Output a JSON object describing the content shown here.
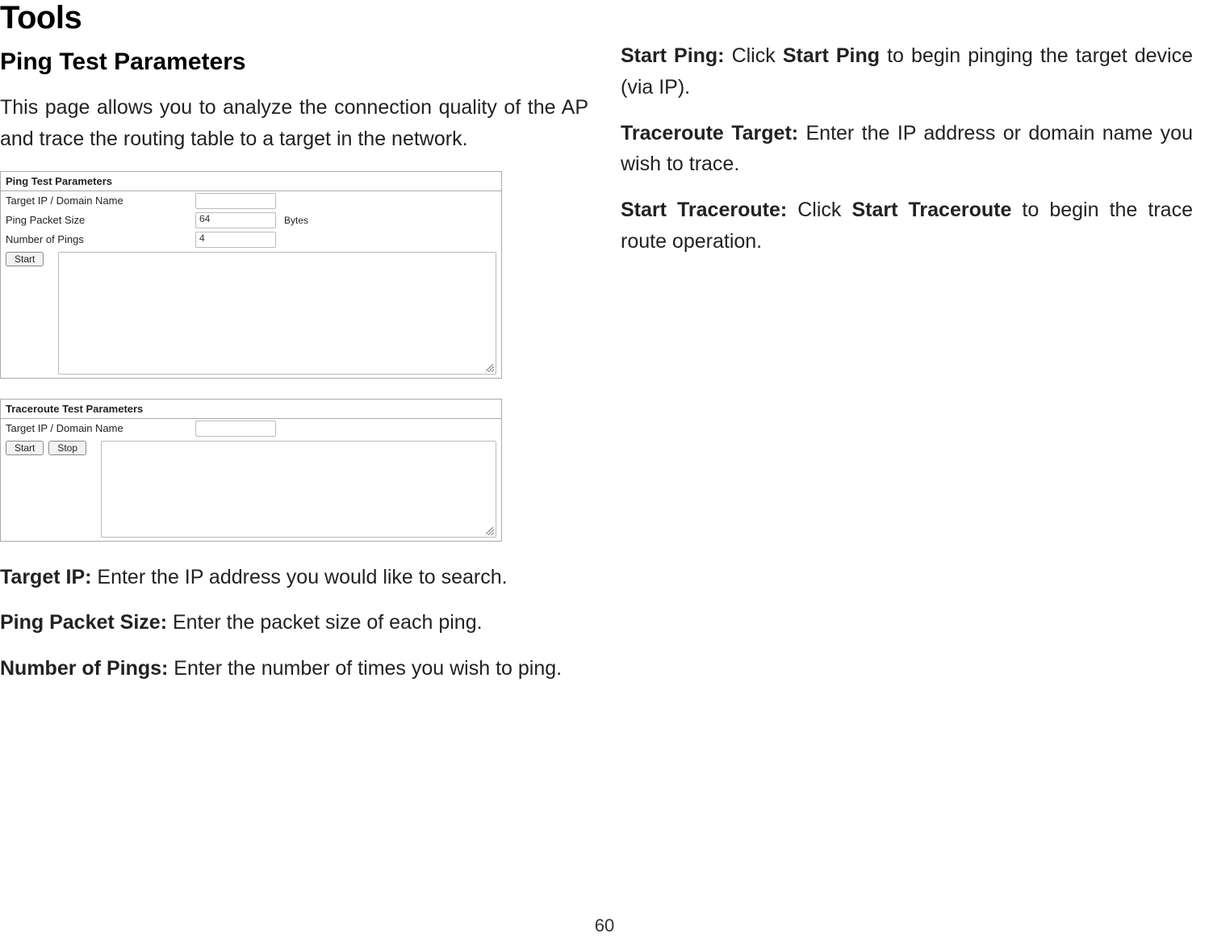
{
  "page_title": "Tools",
  "page_number": "60",
  "left_column": {
    "section_title": "Ping Test Parameters",
    "intro": "This page allows you to analyze the connection quality of the AP and trace the routing table to a target in the network.",
    "ping_panel": {
      "title": "Ping Test Parameters",
      "rows": {
        "target_label": "Target IP / Domain Name",
        "target_value": "",
        "packet_label": "Ping Packet Size",
        "packet_value": "64",
        "packet_unit": "Bytes",
        "num_label": "Number of Pings",
        "num_value": "4"
      },
      "start_button": "Start"
    },
    "traceroute_panel": {
      "title": "Traceroute Test Parameters",
      "target_label": "Target IP / Domain Name",
      "target_value": "",
      "start_button": "Start",
      "stop_button": "Stop"
    },
    "definitions": {
      "target_ip_term": "Target IP:",
      "target_ip_text": " Enter the IP address you would like to search.",
      "packet_size_term": "Ping Packet Size:",
      "packet_size_text": " Enter the packet size of each ping.",
      "num_pings_term": "Number of Pings:",
      "num_pings_text": " Enter the number of times you wish to ping."
    }
  },
  "right_column": {
    "start_ping_term": "Start Ping:",
    "start_ping_text_a": " Click ",
    "start_ping_bold": "Start Ping",
    "start_ping_text_b": " to begin pinging the target device (via IP).",
    "tr_target_term": "Traceroute Target:",
    "tr_target_text": " Enter the IP address or domain name you wish to trace.",
    "start_tr_term": "Start Traceroute:",
    "start_tr_text_a": " Click ",
    "start_tr_bold": "Start Traceroute",
    "start_tr_text_b": " to begin the trace route operation."
  }
}
